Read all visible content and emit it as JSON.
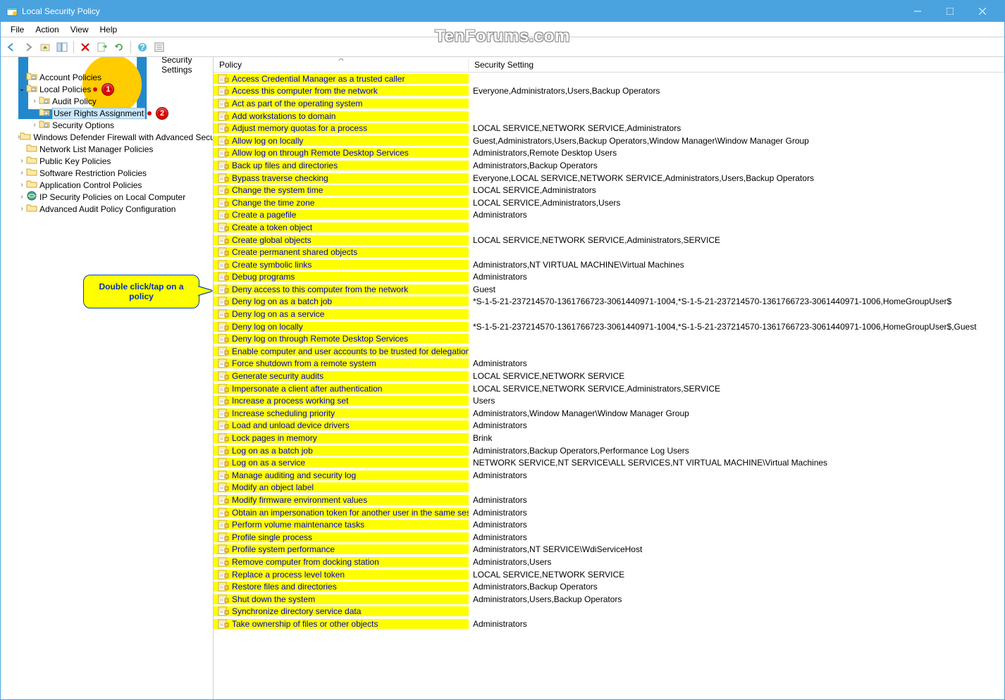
{
  "window": {
    "title": "Local Security Policy"
  },
  "watermark": "TenForums.com",
  "menu": [
    "File",
    "Action",
    "View",
    "Help"
  ],
  "toolbar_icons": [
    "back",
    "forward",
    "up",
    "show-hide-tree",
    "delete",
    "refresh",
    "export",
    "sep",
    "help",
    "properties"
  ],
  "tree": {
    "root": "Security Settings",
    "items": [
      {
        "label": "Account Policies",
        "indent": 1,
        "caret": ">",
        "icon": "folder-policy"
      },
      {
        "label": "Local Policies",
        "indent": 1,
        "caret": "v",
        "icon": "folder-policy",
        "badge": "1"
      },
      {
        "label": "Audit Policy",
        "indent": 2,
        "caret": ">",
        "icon": "folder-policy"
      },
      {
        "label": "User Rights Assignment",
        "indent": 2,
        "caret": "",
        "icon": "folder-policy",
        "selected": true,
        "badge": "2"
      },
      {
        "label": "Security Options",
        "indent": 2,
        "caret": ">",
        "icon": "folder-policy"
      },
      {
        "label": "Windows Defender Firewall with Advanced Security",
        "indent": 1,
        "caret": ">",
        "icon": "folder"
      },
      {
        "label": "Network List Manager Policies",
        "indent": 1,
        "caret": "",
        "icon": "folder"
      },
      {
        "label": "Public Key Policies",
        "indent": 1,
        "caret": ">",
        "icon": "folder"
      },
      {
        "label": "Software Restriction Policies",
        "indent": 1,
        "caret": ">",
        "icon": "folder"
      },
      {
        "label": "Application Control Policies",
        "indent": 1,
        "caret": ">",
        "icon": "folder"
      },
      {
        "label": "IP Security Policies on Local Computer",
        "indent": 1,
        "caret": ">",
        "icon": "ipsec"
      },
      {
        "label": "Advanced Audit Policy Configuration",
        "indent": 1,
        "caret": ">",
        "icon": "folder"
      }
    ]
  },
  "columns": {
    "policy": "Policy",
    "setting": "Security Setting"
  },
  "callout": "Double click/tap on a policy",
  "policies": [
    {
      "p": "Access Credential Manager as a trusted caller",
      "s": ""
    },
    {
      "p": "Access this computer from the network",
      "s": "Everyone,Administrators,Users,Backup Operators"
    },
    {
      "p": "Act as part of the operating system",
      "s": ""
    },
    {
      "p": "Add workstations to domain",
      "s": ""
    },
    {
      "p": "Adjust memory quotas for a process",
      "s": "LOCAL SERVICE,NETWORK SERVICE,Administrators"
    },
    {
      "p": "Allow log on locally",
      "s": "Guest,Administrators,Users,Backup Operators,Window Manager\\Window Manager Group"
    },
    {
      "p": "Allow log on through Remote Desktop Services",
      "s": "Administrators,Remote Desktop Users"
    },
    {
      "p": "Back up files and directories",
      "s": "Administrators,Backup Operators"
    },
    {
      "p": "Bypass traverse checking",
      "s": "Everyone,LOCAL SERVICE,NETWORK SERVICE,Administrators,Users,Backup Operators"
    },
    {
      "p": "Change the system time",
      "s": "LOCAL SERVICE,Administrators"
    },
    {
      "p": "Change the time zone",
      "s": "LOCAL SERVICE,Administrators,Users"
    },
    {
      "p": "Create a pagefile",
      "s": "Administrators"
    },
    {
      "p": "Create a token object",
      "s": ""
    },
    {
      "p": "Create global objects",
      "s": "LOCAL SERVICE,NETWORK SERVICE,Administrators,SERVICE"
    },
    {
      "p": "Create permanent shared objects",
      "s": ""
    },
    {
      "p": "Create symbolic links",
      "s": "Administrators,NT VIRTUAL MACHINE\\Virtual Machines"
    },
    {
      "p": "Debug programs",
      "s": "Administrators"
    },
    {
      "p": "Deny access to this computer from the network",
      "s": "Guest"
    },
    {
      "p": "Deny log on as a batch job",
      "s": "*S-1-5-21-237214570-1361766723-3061440971-1004,*S-1-5-21-237214570-1361766723-3061440971-1006,HomeGroupUser$"
    },
    {
      "p": "Deny log on as a service",
      "s": ""
    },
    {
      "p": "Deny log on locally",
      "s": "*S-1-5-21-237214570-1361766723-3061440971-1004,*S-1-5-21-237214570-1361766723-3061440971-1006,HomeGroupUser$,Guest"
    },
    {
      "p": "Deny log on through Remote Desktop Services",
      "s": ""
    },
    {
      "p": "Enable computer and user accounts to be trusted for delegation",
      "s": ""
    },
    {
      "p": "Force shutdown from a remote system",
      "s": "Administrators"
    },
    {
      "p": "Generate security audits",
      "s": "LOCAL SERVICE,NETWORK SERVICE"
    },
    {
      "p": "Impersonate a client after authentication",
      "s": "LOCAL SERVICE,NETWORK SERVICE,Administrators,SERVICE"
    },
    {
      "p": "Increase a process working set",
      "s": "Users"
    },
    {
      "p": "Increase scheduling priority",
      "s": "Administrators,Window Manager\\Window Manager Group"
    },
    {
      "p": "Load and unload device drivers",
      "s": "Administrators"
    },
    {
      "p": "Lock pages in memory",
      "s": "Brink"
    },
    {
      "p": "Log on as a batch job",
      "s": "Administrators,Backup Operators,Performance Log Users"
    },
    {
      "p": "Log on as a service",
      "s": "NETWORK SERVICE,NT SERVICE\\ALL SERVICES,NT VIRTUAL MACHINE\\Virtual Machines"
    },
    {
      "p": "Manage auditing and security log",
      "s": "Administrators"
    },
    {
      "p": "Modify an object label",
      "s": ""
    },
    {
      "p": "Modify firmware environment values",
      "s": "Administrators"
    },
    {
      "p": "Obtain an impersonation token for another user in the same session",
      "s": "Administrators"
    },
    {
      "p": "Perform volume maintenance tasks",
      "s": "Administrators"
    },
    {
      "p": "Profile single process",
      "s": "Administrators"
    },
    {
      "p": "Profile system performance",
      "s": "Administrators,NT SERVICE\\WdiServiceHost"
    },
    {
      "p": "Remove computer from docking station",
      "s": "Administrators,Users"
    },
    {
      "p": "Replace a process level token",
      "s": "LOCAL SERVICE,NETWORK SERVICE"
    },
    {
      "p": "Restore files and directories",
      "s": "Administrators,Backup Operators"
    },
    {
      "p": "Shut down the system",
      "s": "Administrators,Users,Backup Operators"
    },
    {
      "p": "Synchronize directory service data",
      "s": ""
    },
    {
      "p": "Take ownership of files or other objects",
      "s": "Administrators"
    }
  ]
}
